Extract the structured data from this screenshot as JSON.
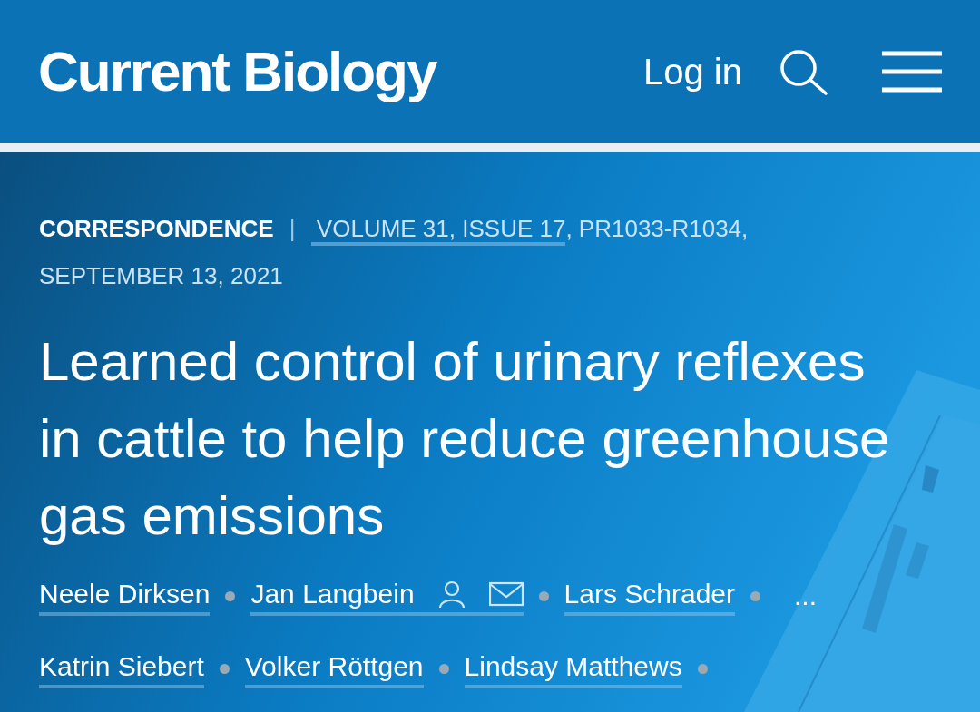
{
  "header": {
    "logo": "Current Biology",
    "login": "Log in"
  },
  "meta": {
    "type": "CORRESPONDENCE",
    "separator": "|",
    "volume_issue": "VOLUME 31, ISSUE 17",
    "pages": ", PR1033-R1034,",
    "date": "SEPTEMBER 13, 2021"
  },
  "title": "Learned control of urinary reflexes in cattle to help reduce greenhouse gas emissions",
  "authors": [
    {
      "kind": "author",
      "name": "Neele Dirksen",
      "corresponding": false
    },
    {
      "kind": "author",
      "name": "Jan Langbein",
      "corresponding": true
    },
    {
      "kind": "author",
      "name": "Lars Schrader",
      "corresponding": false
    },
    {
      "kind": "more",
      "name": "..."
    },
    {
      "kind": "author",
      "name": "Katrin Siebert",
      "corresponding": false
    },
    {
      "kind": "author",
      "name": "Volker Röttgen",
      "corresponding": false
    },
    {
      "kind": "author",
      "name": "Lindsay Matthews",
      "corresponding": false
    }
  ]
}
